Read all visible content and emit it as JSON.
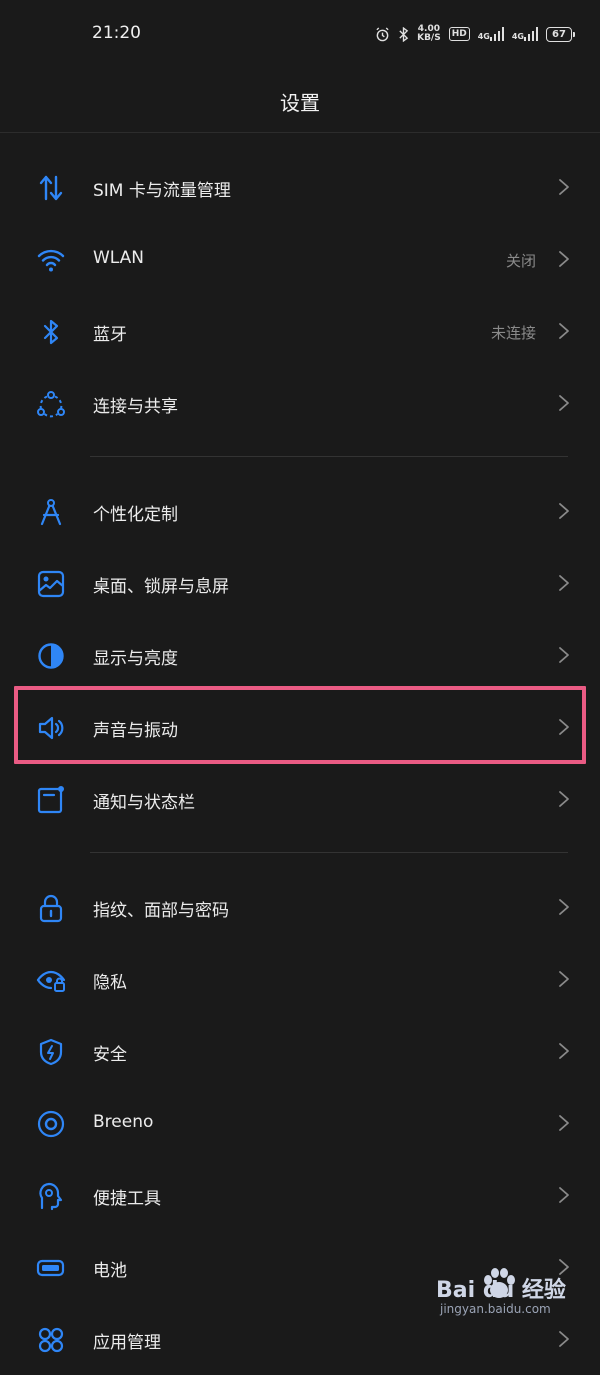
{
  "status": {
    "time": "21:20",
    "speed_value": "4.00",
    "speed_unit": "KB/S",
    "hd": "HD",
    "net1": "4G",
    "net2": "4G",
    "battery": "67"
  },
  "header": {
    "title": "设置"
  },
  "rows": [
    {
      "label": "SIM 卡与流量管理",
      "value": "",
      "icon": "data-transfer-icon"
    },
    {
      "label": "WLAN",
      "value": "关闭",
      "icon": "wifi-icon"
    },
    {
      "label": "蓝牙",
      "value": "未连接",
      "icon": "bluetooth-icon"
    },
    {
      "label": "连接与共享",
      "value": "",
      "icon": "connection-share-icon"
    },
    {
      "label": "个性化定制",
      "value": "",
      "icon": "compass-icon"
    },
    {
      "label": "桌面、锁屏与息屏",
      "value": "",
      "icon": "wallpaper-icon"
    },
    {
      "label": "显示与亮度",
      "value": "",
      "icon": "brightness-icon"
    },
    {
      "label": "声音与振动",
      "value": "",
      "icon": "speaker-icon"
    },
    {
      "label": "通知与状态栏",
      "value": "",
      "icon": "notification-icon"
    },
    {
      "label": "指纹、面部与密码",
      "value": "",
      "icon": "lock-icon"
    },
    {
      "label": "隐私",
      "value": "",
      "icon": "privacy-eye-icon"
    },
    {
      "label": "安全",
      "value": "",
      "icon": "shield-icon"
    },
    {
      "label": "Breeno",
      "value": "",
      "icon": "breeno-icon"
    },
    {
      "label": "便捷工具",
      "value": "",
      "icon": "tools-icon"
    },
    {
      "label": "电池",
      "value": "",
      "icon": "battery-icon"
    },
    {
      "label": "应用管理",
      "value": "",
      "icon": "apps-icon"
    }
  ],
  "watermark": {
    "logo": "Bai du 经验",
    "sub": "jingyan.baidu.com"
  },
  "colors": {
    "accent": "#2f86f6",
    "highlight": "#ea5b84",
    "background": "#1a1a1a"
  }
}
